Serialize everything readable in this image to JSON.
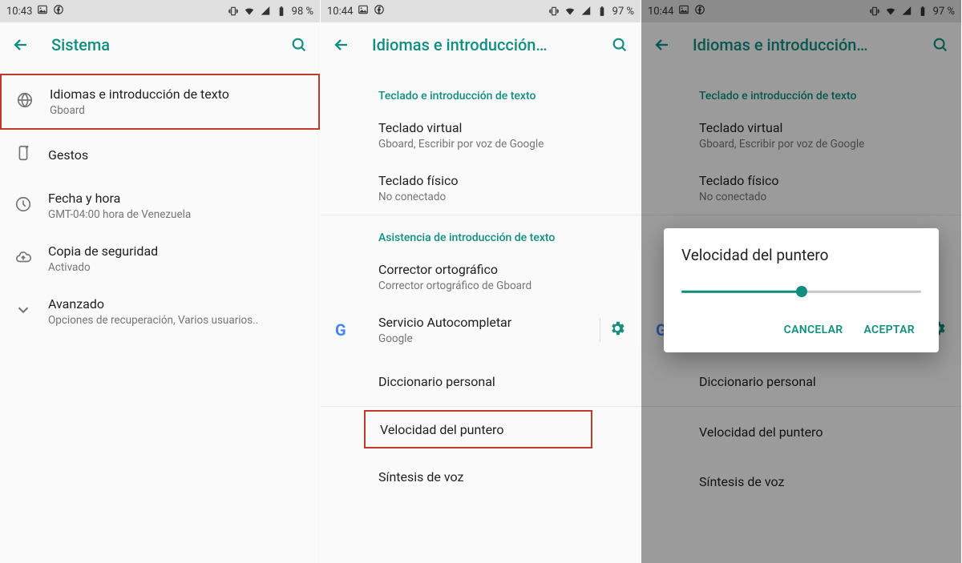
{
  "panel1": {
    "status": {
      "time": "10:43",
      "battery": "98 %"
    },
    "appbar": {
      "title": "Sistema"
    },
    "items": [
      {
        "title": "Idiomas e introducción de texto",
        "subtitle": "Gboard"
      },
      {
        "title": "Gestos",
        "subtitle": null
      },
      {
        "title": "Fecha y hora",
        "subtitle": "GMT-04:00 hora de Venezuela"
      },
      {
        "title": "Copia de seguridad",
        "subtitle": "Activado"
      },
      {
        "title": "Avanzado",
        "subtitle": "Opciones de recuperación, Varios usuarios.."
      }
    ]
  },
  "panel2": {
    "status": {
      "time": "10:44",
      "battery": "97 %"
    },
    "appbar": {
      "title": "Idiomas e introducción…"
    },
    "section1": "Teclado e introducción de texto",
    "items1": [
      {
        "title": "Teclado virtual",
        "subtitle": "Gboard, Escribir por voz de Google"
      },
      {
        "title": "Teclado físico",
        "subtitle": "No conectado"
      }
    ],
    "section2": "Asistencia de introducción de texto",
    "items2": [
      {
        "title": "Corrector ortográfico",
        "subtitle": "Corrector ortográfico de Gboard"
      },
      {
        "title": "Servicio Autocompletar",
        "subtitle": "Google"
      },
      {
        "title": "Diccionario personal",
        "subtitle": null
      },
      {
        "title": "Velocidad del puntero",
        "subtitle": null
      },
      {
        "title": "Síntesis de voz",
        "subtitle": null
      }
    ]
  },
  "panel3": {
    "status": {
      "time": "10:44",
      "battery": "97 %"
    },
    "dialog": {
      "title": "Velocidad del puntero",
      "value_percent": 50,
      "cancel": "CANCELAR",
      "accept": "ACEPTAR"
    }
  }
}
